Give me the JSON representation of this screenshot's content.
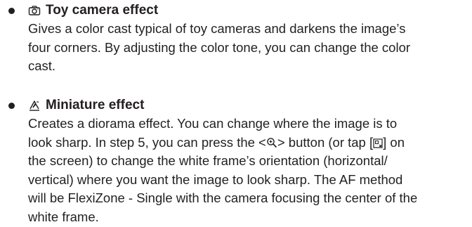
{
  "items": [
    {
      "icon": "toy-camera-icon",
      "title": "Toy camera effect",
      "lines": [
        "Gives a color cast typical of toy cameras and darkens the image’s",
        "four corners. By adjusting the color tone, you can change the color",
        "cast."
      ]
    },
    {
      "icon": "miniature-effect-icon",
      "title": "Miniature effect",
      "lines": [
        "Creates a diorama effect. You can change where the image is to",
        "look sharp. In step 5, you can press the <",
        "> button (or tap [",
        "] on",
        "the screen) to change the white frame’s orientation (horizontal/",
        "vertical) where you want the image to look sharp. The AF method",
        "will be FlexiZone - Single with the camera focusing the center of the",
        "white frame."
      ]
    }
  ]
}
